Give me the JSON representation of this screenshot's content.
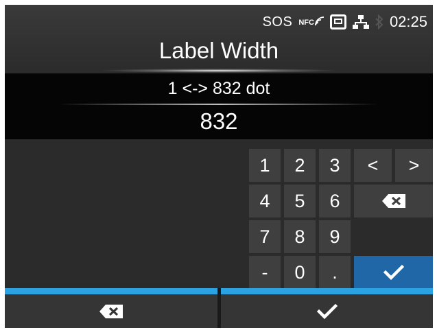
{
  "status": {
    "sos": "SOS",
    "nfc": "NFC",
    "time": "02:25",
    "icons": [
      "nfc-signal-icon",
      "sd-card-icon",
      "network-icon",
      "bluetooth-icon"
    ]
  },
  "title": "Label Width",
  "range": "1 <-> 832 dot",
  "value": "832",
  "keypad": {
    "digits": [
      "1",
      "2",
      "3",
      "4",
      "5",
      "6",
      "7",
      "8",
      "9",
      "0"
    ],
    "minus": "-",
    "dot": ".",
    "left": "<",
    "right": ">"
  },
  "colors": {
    "accent": "#2ba3e2",
    "ok": "#1f67a6",
    "key": "#3f3f3f"
  }
}
